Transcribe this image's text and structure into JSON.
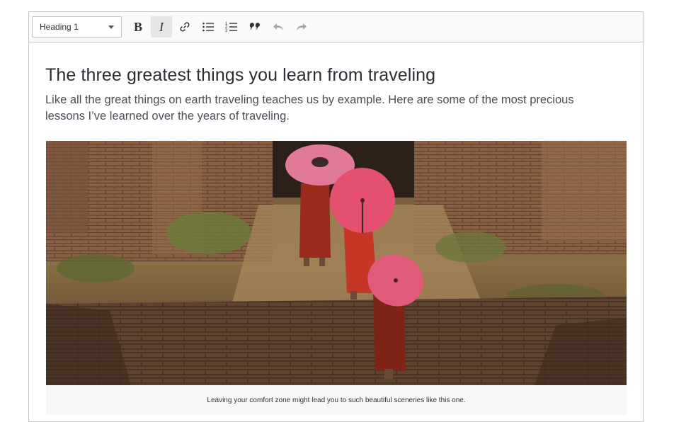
{
  "toolbar": {
    "heading_select": {
      "value": "Heading 1"
    },
    "buttons": [
      {
        "name": "bold",
        "icon": "bold-icon"
      },
      {
        "name": "italic",
        "icon": "italic-icon",
        "active": true
      },
      {
        "name": "link",
        "icon": "link-icon"
      },
      {
        "name": "bulleted-list",
        "icon": "bulleted-list-icon"
      },
      {
        "name": "numbered-list",
        "icon": "numbered-list-icon"
      },
      {
        "name": "block-quote",
        "icon": "quote-icon"
      },
      {
        "name": "undo",
        "icon": "undo-icon",
        "disabled": true
      },
      {
        "name": "redo",
        "icon": "redo-icon",
        "disabled": true
      }
    ]
  },
  "document": {
    "title": "The three greatest things you learn from traveling",
    "lead": "Like all the great things on earth traveling teaches us by example. Here are some of the most precious lessons I’ve learned over the years of traveling.",
    "figure": {
      "image": "photo of monks with pink parasols walking up ancient brick steps",
      "caption": "Leaving your comfort zone might lead you to such beautiful sceneries like this one."
    }
  },
  "colors": {
    "toolbar_bg": "#fafafa",
    "border": "#c4c4c4",
    "active_button": "#e6e6e6",
    "parasol": "#e05a7a"
  }
}
